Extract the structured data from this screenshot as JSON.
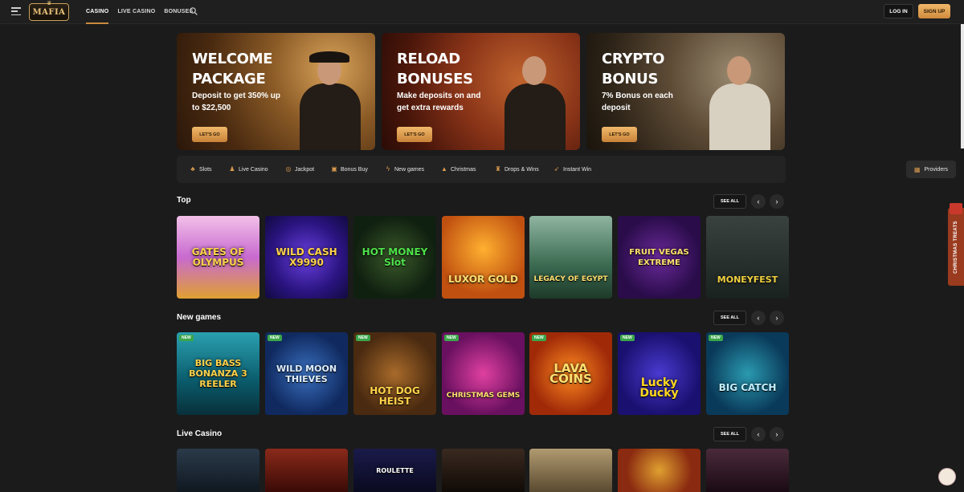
{
  "header": {
    "logo_text": "MAFIA",
    "nav": [
      "CASINO",
      "LIVE CASINO",
      "BONUSES"
    ],
    "login_label": "LOG IN",
    "signup_label": "SIGN UP"
  },
  "banners": [
    {
      "title": "WELCOME PACKAGE",
      "text": "Deposit to get 350% up to $22,500",
      "button": "LET'S GO"
    },
    {
      "title": "RELOAD BONUSES",
      "text": "Make deposits on and get extra rewards",
      "button": "LET'S GO"
    },
    {
      "title": "CRYPTO BONUS",
      "text": "7% Bonus on each deposit",
      "button": "LET'S GO"
    }
  ],
  "categories": [
    "Slots",
    "Live Casino",
    "Jackpot",
    "Bonus Buy",
    "New games",
    "Christmas",
    "Drops & Wins",
    "Instant Win"
  ],
  "providers_label": "Providers",
  "sections": {
    "top": {
      "title": "Top",
      "see_all": "SEE ALL",
      "games": [
        "GATES OF OLYMPUS",
        "WILD CASH X9990",
        "HOT MONEY Slot",
        "LUXOR GOLD",
        "LEGACY OF EGYPT",
        "FRUIT VEGAS EXTREME",
        "MONEYFEST"
      ]
    },
    "new_games": {
      "title": "New games",
      "see_all": "SEE ALL",
      "new_badge": "NEW",
      "games": [
        "BIG BASS BONANZA 3 REELER",
        "WILD MOON THIEVES",
        "HOT DOG HEIST",
        "CHRISTMAS GEMS",
        "LAVA COINS",
        "Lucky Ducky",
        "BIG CATCH"
      ]
    },
    "live_casino": {
      "title": "Live Casino",
      "see_all": "SEE ALL",
      "games": [
        "",
        "",
        "ROULETTE",
        "",
        "",
        "",
        ""
      ]
    }
  },
  "side_tab": "CHRISTMAS TREATS",
  "colors": {
    "accent": "#d99a4e",
    "background": "#1b1b1b",
    "new_badge": "#3aa64a"
  }
}
